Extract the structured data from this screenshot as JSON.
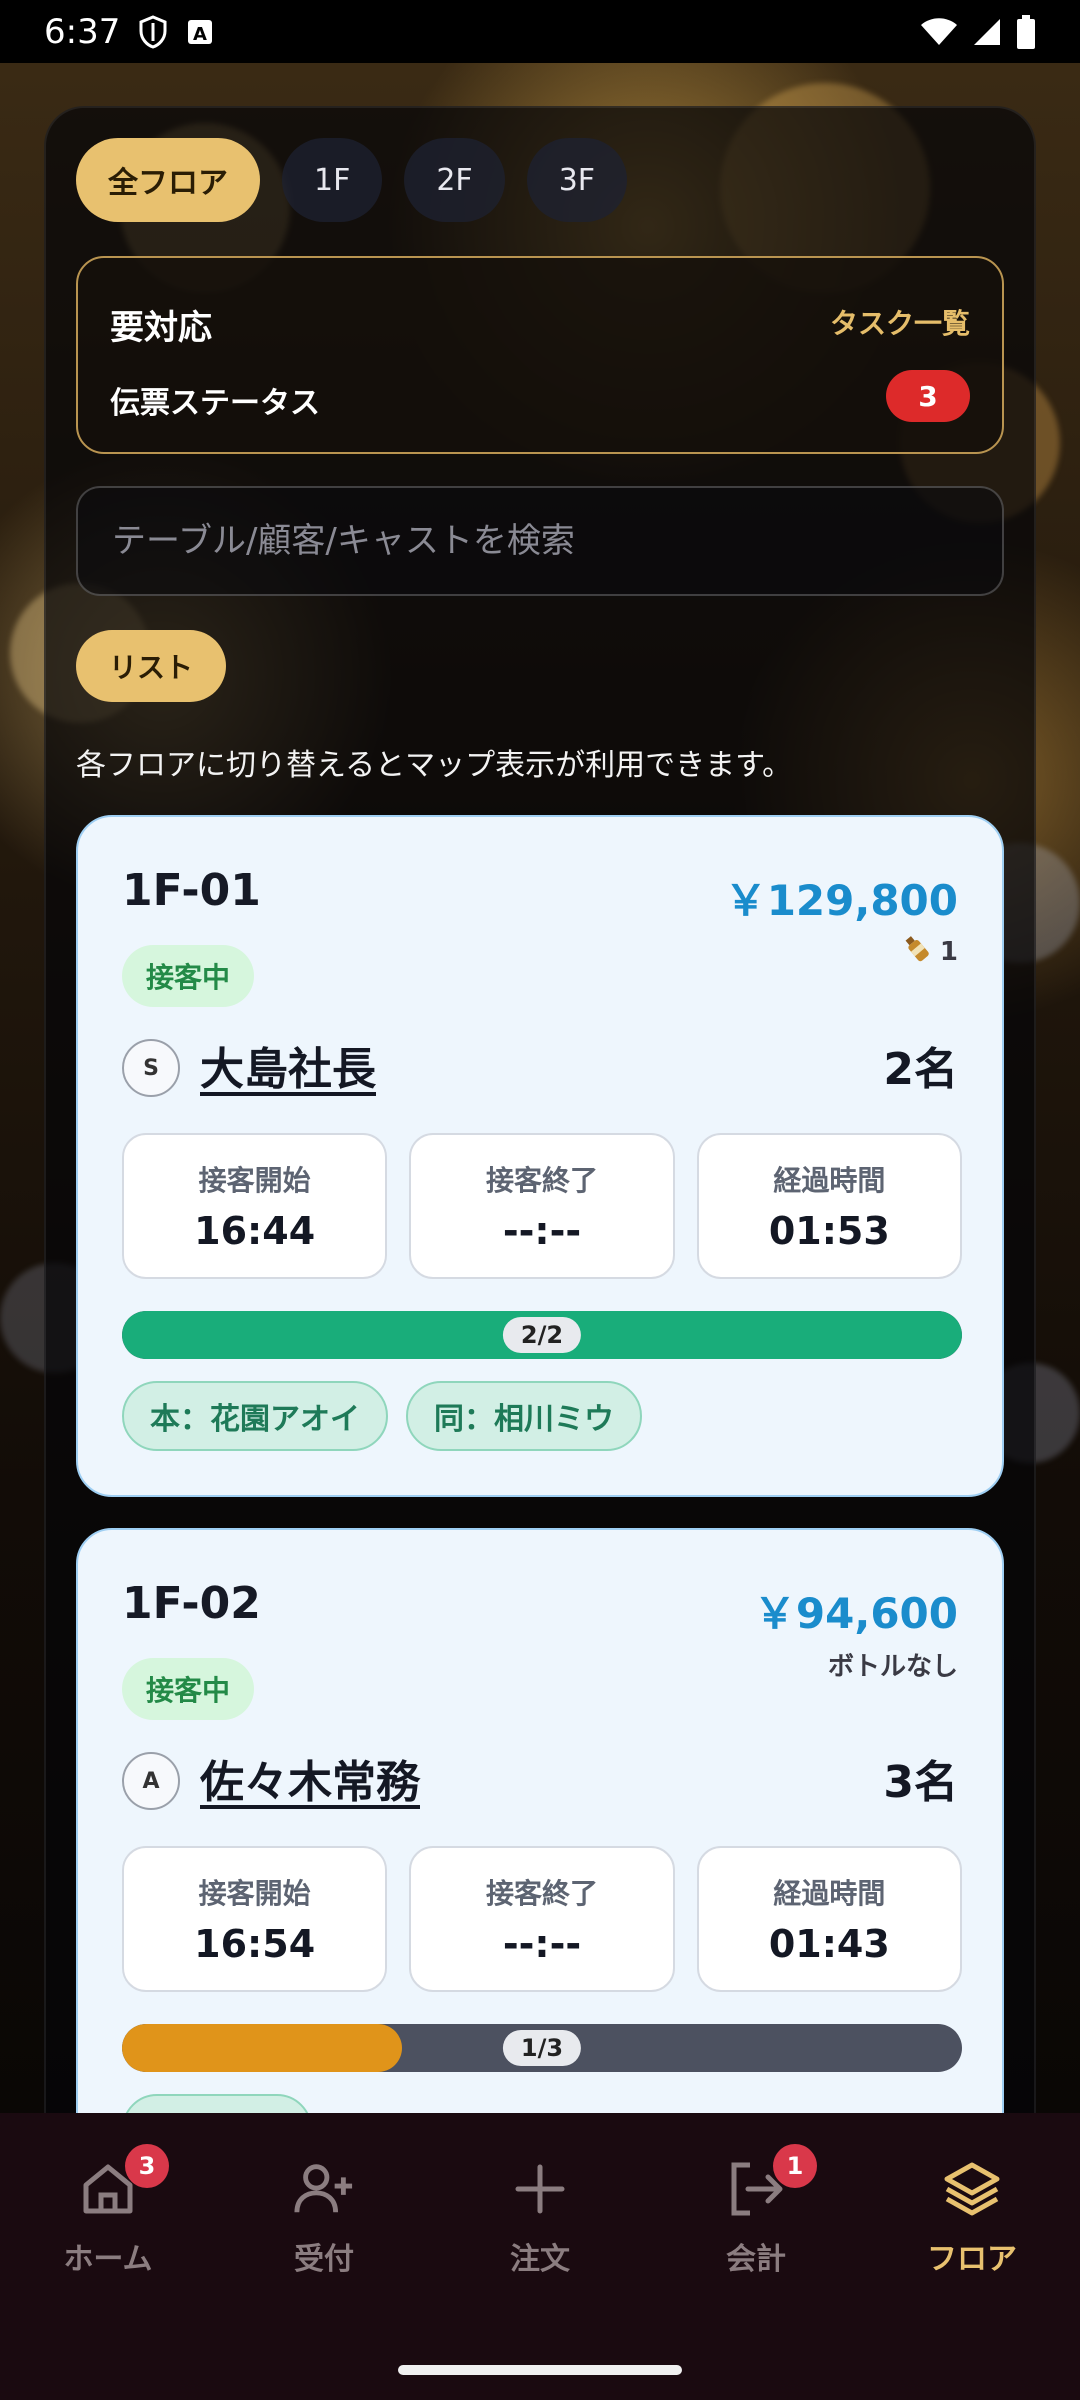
{
  "status_bar": {
    "time": "6:37",
    "icons": [
      "shield-icon",
      "a-notification-icon",
      "wifi-icon",
      "signal-icon",
      "battery-icon"
    ]
  },
  "floor_tabs": [
    {
      "label": "全フロア",
      "active": true
    },
    {
      "label": "1F",
      "active": false
    },
    {
      "label": "2F",
      "active": false
    },
    {
      "label": "3F",
      "active": false
    }
  ],
  "alert": {
    "title": "要対応",
    "link": "タスク一覧",
    "row_label": "伝票ステータス",
    "count": "3"
  },
  "search": {
    "placeholder": "テーブル/顧客/キャストを検索",
    "value": ""
  },
  "view_toggle": "リスト",
  "hint": "各フロアに切り替えるとマップ表示が利用できます。",
  "tables": [
    {
      "id": "1F-01",
      "amount": "￥129,800",
      "bottle": "1",
      "status": "接客中",
      "rank": "S",
      "customer": "大島社長",
      "guests": "2名",
      "times": [
        {
          "label": "接客開始",
          "value": "16:44"
        },
        {
          "label": "接客終了",
          "value": "--:--"
        },
        {
          "label": "経過時間",
          "value": "01:53"
        }
      ],
      "progress_label": "2/2",
      "progress": 1.0,
      "progress_color": "#19ad7a",
      "casts": [
        "本：花園アオイ",
        "同：相川ミウ"
      ]
    },
    {
      "id": "1F-02",
      "amount": "￥94,600",
      "bottle": "ボトルなし",
      "status": "接客中",
      "rank": "A",
      "customer": "佐々木常務",
      "guests": "3名",
      "times": [
        {
          "label": "接客開始",
          "value": "16:54"
        },
        {
          "label": "接客終了",
          "value": "--:--"
        },
        {
          "label": "経過時間",
          "value": "01:43"
        }
      ],
      "progress_label": "1/3",
      "progress": 0.333,
      "progress_color": "#e0941a"
    }
  ],
  "nav": [
    {
      "label": "ホーム",
      "icon": "home-icon",
      "badge": "3",
      "active": false
    },
    {
      "label": "受付",
      "icon": "user-plus-icon",
      "active": false
    },
    {
      "label": "注文",
      "icon": "plus-icon",
      "active": false
    },
    {
      "label": "会計",
      "icon": "logout-icon",
      "badge": "1",
      "active": false
    },
    {
      "label": "フロア",
      "icon": "layers-icon",
      "active": true
    }
  ],
  "colors": {
    "accent_gold": "#e8c16f",
    "amount_blue": "#1a8ccc",
    "alert_red": "#dd2a2a",
    "status_green": "#238a47"
  }
}
